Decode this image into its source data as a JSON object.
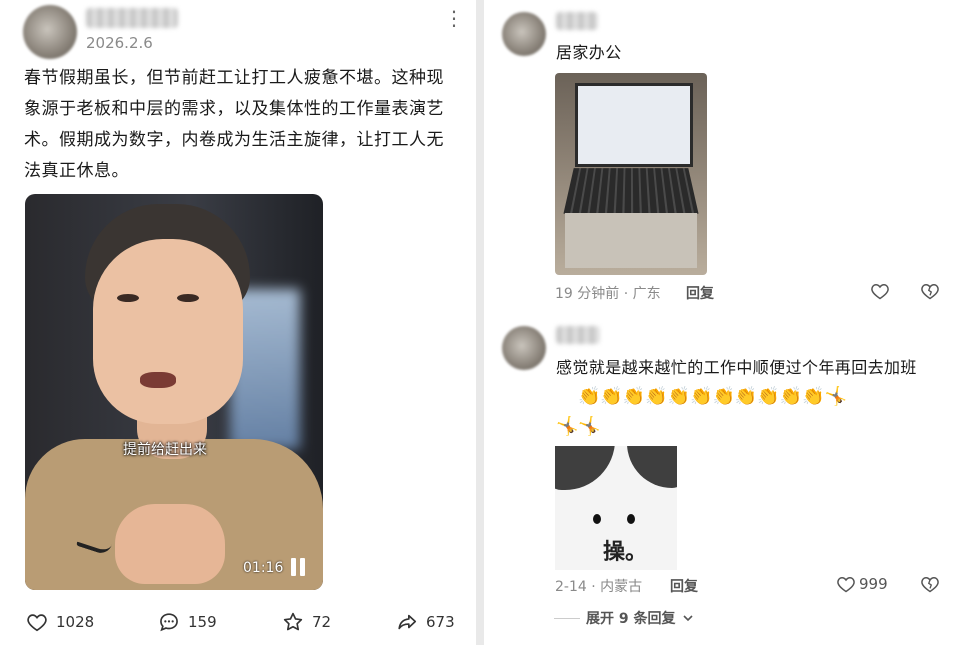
{
  "post": {
    "date": "2026.2.6",
    "menu_glyph": "⋮",
    "text": "春节假期虽长，但节前赶工让打工人疲惫不堪。这种现象源于老板和中层的需求，以及集体性的工作量表演艺术。假期成为数字，内卷成为生活主旋律，让打工人无法真正休息。",
    "video": {
      "caption": "提前给赶出来",
      "time": "01:16"
    },
    "stats": {
      "likes": "1028",
      "comments": "159",
      "stars": "72",
      "shares": "673"
    }
  },
  "comments": [
    {
      "text": "居家办公",
      "time": "19 分钟前 · 广东",
      "reply_label": "回复"
    },
    {
      "text": "感觉就是越来越忙的工作中顺便过个年再回去加班",
      "emoji_line1": "👏👏👏👏👏👏👏👏👏👏👏🤸",
      "emoji_line2": "🤸🤸",
      "sticker_text": "操。",
      "time": "2-14 · 内蒙古",
      "reply_label": "回复",
      "likes": "999",
      "expand": "展开 9 条回复"
    }
  ],
  "colors": {
    "muted": "#8a8a8a",
    "text": "#1a1a1a"
  }
}
